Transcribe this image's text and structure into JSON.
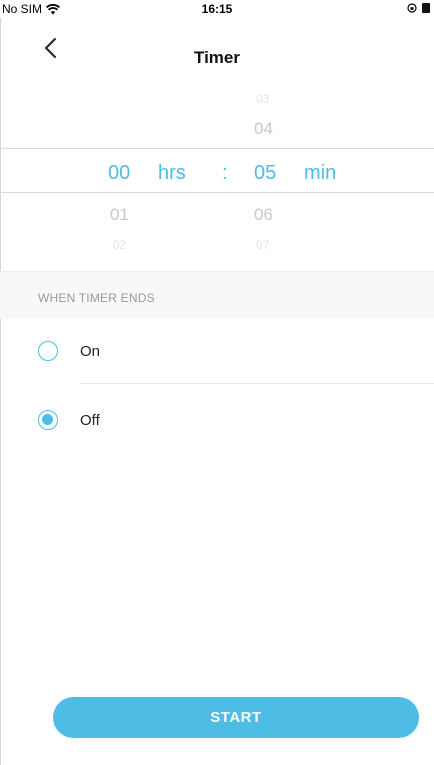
{
  "status_bar": {
    "carrier": "No SIM",
    "time": "16:15"
  },
  "nav": {
    "title": "Timer"
  },
  "picker": {
    "hours": {
      "above_faint": "",
      "above": "",
      "selected": "00",
      "below": "01",
      "below_faint": "02",
      "unit": "hrs"
    },
    "separator": ":",
    "minutes": {
      "above_faint": "03",
      "above": "04",
      "selected": "05",
      "below": "06",
      "below_faint": "07",
      "unit": "min"
    }
  },
  "when_timer_ends": {
    "header": "WHEN TIMER ENDS",
    "options": [
      {
        "label": "On",
        "selected": false
      },
      {
        "label": "Off",
        "selected": true
      }
    ]
  },
  "start_label": "START",
  "colors": {
    "accent": "#4dbde6",
    "divider": "#dcdcdc",
    "section_bg": "#f8f8f9"
  },
  "icons": [
    "wifi-icon",
    "rotation-lock-icon",
    "battery-icon",
    "back-chevron-icon"
  ]
}
